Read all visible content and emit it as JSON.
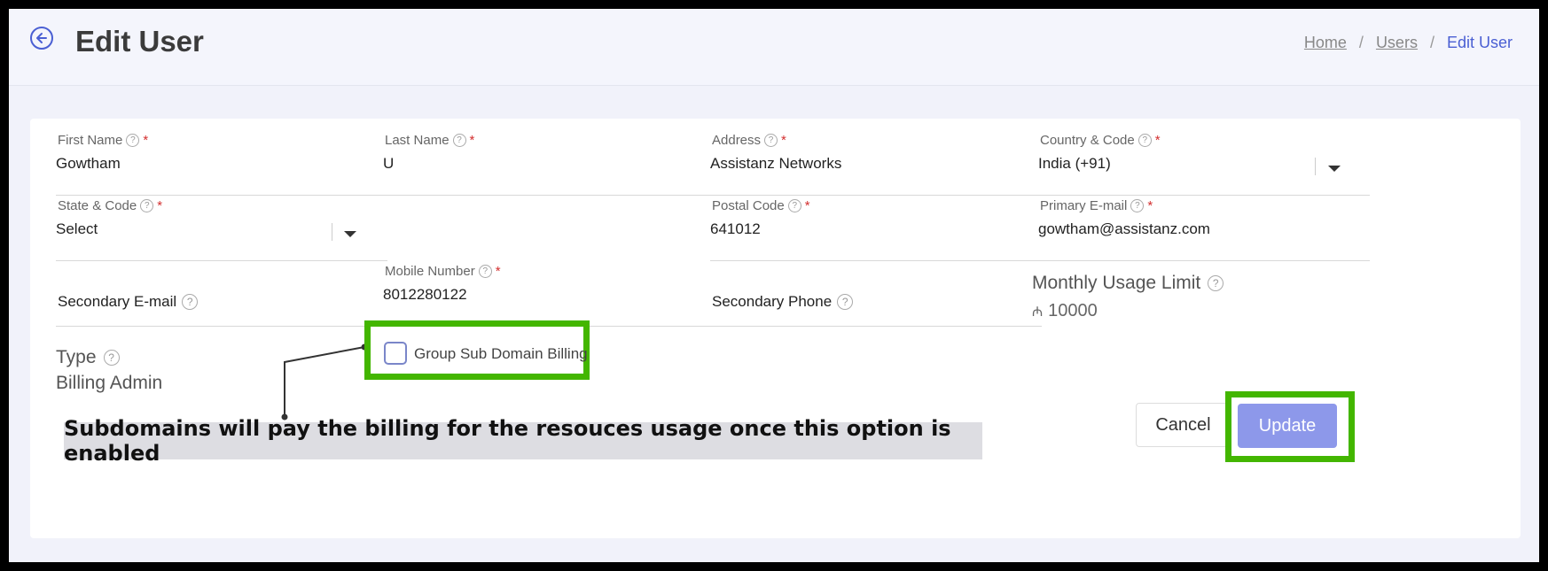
{
  "header": {
    "title": "Edit User",
    "breadcrumb": [
      "Home",
      "Users",
      "Edit User"
    ],
    "breadcrumb_sep": "/"
  },
  "form": {
    "first_name": {
      "label": "First Name",
      "value": "Gowtham"
    },
    "last_name": {
      "label": "Last Name",
      "value": "U"
    },
    "address": {
      "label": "Address",
      "value": "Assistanz Networks"
    },
    "country": {
      "label": "Country & Code",
      "value": "India (+91)"
    },
    "state": {
      "label": "State & Code",
      "value": "Select"
    },
    "postal_code": {
      "label": "Postal Code",
      "value": "641012"
    },
    "primary_email": {
      "label": "Primary E-mail",
      "value": "gowtham@assistanz.com"
    },
    "secondary_email": {
      "label": "Secondary E-mail",
      "value": ""
    },
    "mobile": {
      "label": "Mobile Number",
      "value": "8012280122"
    },
    "secondary_phone": {
      "label": "Secondary Phone",
      "value": ""
    },
    "monthly_usage": {
      "label": "Monthly Usage Limit",
      "currency": "₼",
      "value": "10000"
    },
    "type": {
      "label": "Type",
      "value": "Billing Admin"
    },
    "group_billing": {
      "label": "Group Sub Domain Billing",
      "checked": false
    },
    "required_mark": "*",
    "help_glyph": "?"
  },
  "annotation": {
    "note": "Subdomains will pay the billing for the resouces usage once this option is enabled",
    "highlight_color": "#43b600"
  },
  "actions": {
    "cancel_label": "Cancel",
    "update_label": "Update"
  },
  "colors": {
    "accent": "#4a5fd3",
    "update_button": "#8d98ea",
    "required": "#d32f2f"
  }
}
